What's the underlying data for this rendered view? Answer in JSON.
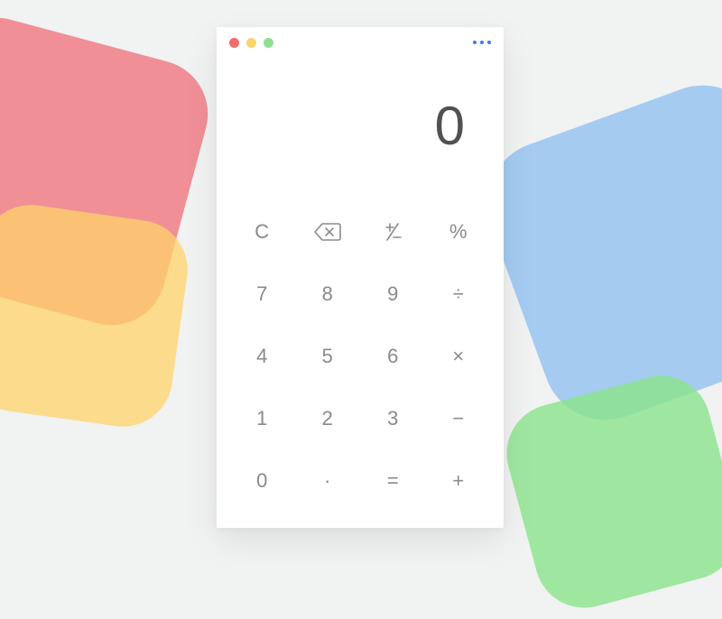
{
  "display": {
    "value": "0"
  },
  "keys": {
    "clear": "C",
    "plusminus": "⁺∕₋",
    "percent": "%",
    "seven": "7",
    "eight": "8",
    "nine": "9",
    "divide": "÷",
    "four": "4",
    "five": "5",
    "six": "6",
    "multiply": "×",
    "one": "1",
    "two": "2",
    "three": "3",
    "minus": "−",
    "zero": "0",
    "decimal": "·",
    "equals": "=",
    "plus": "+"
  },
  "colors": {
    "traffic_close": "#f36b6b",
    "traffic_min": "#f9d36b",
    "traffic_max": "#8fe08f",
    "more_dot": "#3f7de0",
    "key_fg": "#8a8a8a",
    "display_fg": "#515151",
    "bg": "#f1f2f2"
  }
}
